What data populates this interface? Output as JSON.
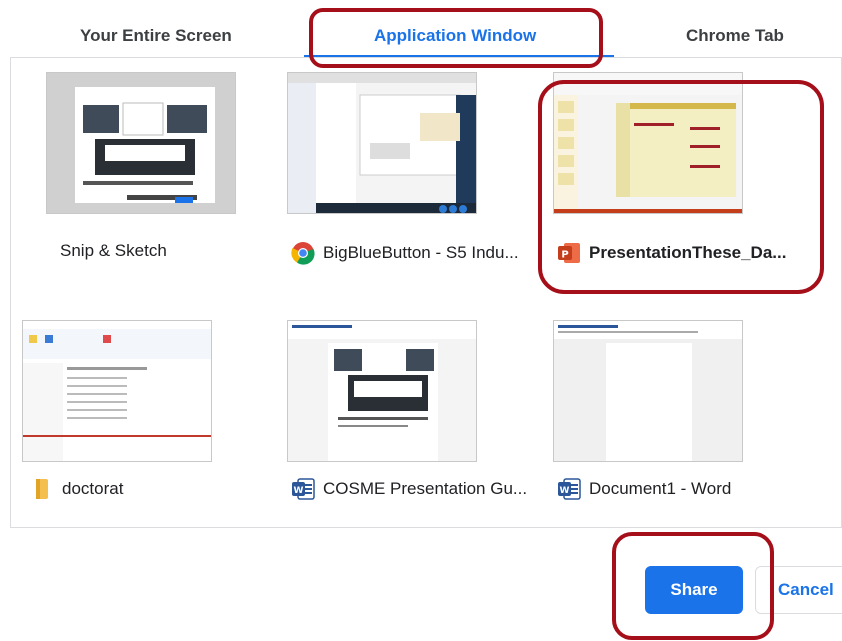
{
  "tabs": [
    {
      "label": "Your Entire Screen"
    },
    {
      "label": "Application Window"
    },
    {
      "label": "Chrome Tab"
    }
  ],
  "windows": [
    {
      "title": "Snip & Sketch",
      "icon": "snip-sketch-icon"
    },
    {
      "title": "BigBlueButton - S5 Indu...",
      "icon": "chrome-icon"
    },
    {
      "title": "PresentationThese_Da...",
      "icon": "powerpoint-icon",
      "selected": true
    },
    {
      "title": "doctorat",
      "icon": "folder-icon"
    },
    {
      "title": "COSME Presentation Gu...",
      "icon": "word-icon"
    },
    {
      "title": "Document1 - Word",
      "icon": "word-icon"
    }
  ],
  "buttons": {
    "share": "Share",
    "cancel": "Cancel"
  },
  "colors": {
    "accent": "#1a73e8",
    "highlight": "#a50f1a"
  }
}
